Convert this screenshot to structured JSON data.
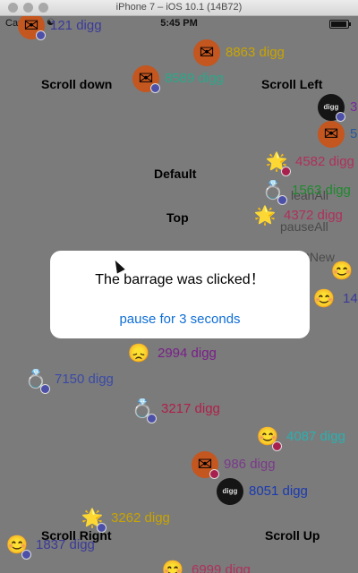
{
  "window": {
    "title": "iPhone 7 – iOS 10.1 (14B72)"
  },
  "status": {
    "carrier": "Carrier",
    "time": "5:45 PM"
  },
  "buttons": {
    "scroll_down": "Scroll down",
    "scroll_left": "Scroll Left",
    "default": "Default",
    "top": "Top",
    "scroll_right": "Scroll Right",
    "scroll_up": "Scroll Up",
    "clean_all": "leanAll",
    "pause_all": "pauseAll",
    "new": "tNew"
  },
  "barrages": [
    {
      "text": "121 digg",
      "color": "#3a3a9a",
      "avatar": "orange",
      "badge": "blue"
    },
    {
      "text": "8863 digg",
      "color": "#c9a400",
      "avatar": "orange",
      "badge": "none"
    },
    {
      "text": "8589 digg",
      "color": "#2aa88a",
      "avatar": "orange",
      "badge": "blue"
    },
    {
      "text": "3",
      "color": "#7a2a9a",
      "avatar": "black",
      "badge": "blue"
    },
    {
      "text": "5",
      "color": "#2a5a9a",
      "avatar": "orange",
      "badge": "none"
    },
    {
      "text": "4582 digg",
      "color": "#b0305a",
      "avatar": "star",
      "badge": "pink"
    },
    {
      "text": "1563 digg",
      "color": "#1f8a2f",
      "avatar": "ring",
      "badge": "blue"
    },
    {
      "text": "4372 digg",
      "color": "#b0305a",
      "avatar": "star",
      "badge": "none"
    },
    {
      "text": "14",
      "color": "#3a3a9a",
      "avatar": "smile",
      "badge": "none"
    },
    {
      "text": "2994 digg",
      "color": "#7a1f8a",
      "avatar": "sad",
      "badge": "none"
    },
    {
      "text": "7150 digg",
      "color": "#3a4aa8",
      "avatar": "ring",
      "badge": "blue"
    },
    {
      "text": "3217 digg",
      "color": "#b0204a",
      "avatar": "ring",
      "badge": "blue"
    },
    {
      "text": "4087 digg",
      "color": "#2ab0b0",
      "avatar": "smile",
      "badge": "pink"
    },
    {
      "text": "986 digg",
      "color": "#7a3a8a",
      "avatar": "orange",
      "badge": "pink"
    },
    {
      "text": "8051 digg",
      "color": "#1a3ab0",
      "avatar": "black",
      "badge": "none"
    },
    {
      "text": "3262 digg",
      "color": "#c9a400",
      "avatar": "star",
      "badge": "blue"
    },
    {
      "text": "1837 digg",
      "color": "#3a3a9a",
      "avatar": "smile",
      "badge": "blue"
    },
    {
      "text": "6999 digg",
      "color": "#b0305a",
      "avatar": "smile",
      "badge": "none"
    }
  ],
  "dialog": {
    "title": "The barrage was clicked！",
    "button": "pause for 3 seconds"
  },
  "colors": {
    "dialog_button": "#0f6ed6",
    "overlay": "#6b6b6b"
  },
  "icons": {
    "star": "glowing-star-icon",
    "ring": "diamond-ring-icon",
    "smile": "smiling-face-icon",
    "sad": "sad-face-icon",
    "orange": "envelope-icon",
    "black": "digg-logo-icon"
  }
}
